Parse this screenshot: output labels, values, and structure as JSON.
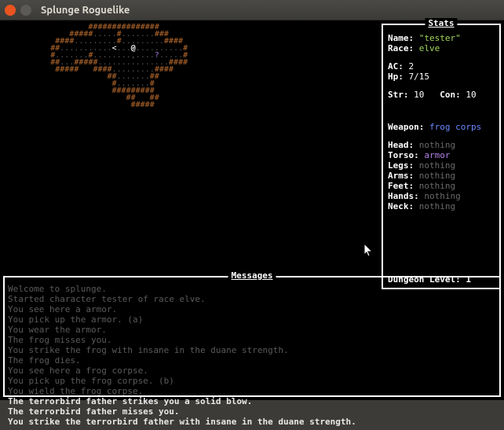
{
  "window": {
    "title": "Splunge Roguelike"
  },
  "stats": {
    "box_title": "Stats",
    "name_lbl": "Name:",
    "name_val": "\"tester\"",
    "race_lbl": "Race:",
    "race_val": "elve",
    "ac_lbl": "AC:",
    "ac_val": "2",
    "hp_lbl": "Hp:",
    "hp_val": "7/15",
    "str_lbl": "Str:",
    "str_val": "10",
    "con_lbl": "Con:",
    "con_val": "10",
    "weapon_lbl": "Weapon:",
    "weapon_val": "frog corps",
    "slots": [
      {
        "lbl": "Head:",
        "val": "nothing",
        "cls": "val-dim"
      },
      {
        "lbl": "Torso:",
        "val": "armor",
        "cls": "val-purp"
      },
      {
        "lbl": "Legs:",
        "val": "nothing",
        "cls": "val-dim"
      },
      {
        "lbl": "Arms:",
        "val": "nothing",
        "cls": "val-dim"
      },
      {
        "lbl": "Feet:",
        "val": "nothing",
        "cls": "val-dim"
      },
      {
        "lbl": "Hands:",
        "val": "nothing",
        "cls": "val-dim"
      },
      {
        "lbl": "Neck:",
        "val": "nothing",
        "cls": "val-dim"
      }
    ],
    "dungeon_lbl": "Dungeon Level:",
    "dungeon_val": "1"
  },
  "messages": {
    "box_title": "Messages",
    "lines": [
      {
        "text": "Welcome to splunge.",
        "cls": "msg-dim"
      },
      {
        "text": "Started character tester of race elve.",
        "cls": "msg-dim"
      },
      {
        "text": "You see here a armor.",
        "cls": "msg-dim"
      },
      {
        "text": "You pick up the armor. (a)",
        "cls": "msg-dim"
      },
      {
        "text": "You wear the armor.",
        "cls": "msg-dim"
      },
      {
        "text": "The frog misses you.",
        "cls": "msg-dim"
      },
      {
        "text": "You strike the frog with insane in the duane strength.",
        "cls": "msg-dim"
      },
      {
        "text": "The frog dies.",
        "cls": "msg-dim"
      },
      {
        "text": "You see here a frog corpse.",
        "cls": "msg-dim"
      },
      {
        "text": "You pick up the frog corpse. (b)",
        "cls": "msg-dim"
      },
      {
        "text": "You wield the frog corpse.",
        "cls": "msg-dim"
      },
      {
        "text": "The terrorbird father strikes you a solid blow.",
        "cls": "msg-brite"
      },
      {
        "text": "The terrorbird father misses you.",
        "cls": "msg-brite"
      },
      {
        "text": "You strike the terrorbird father with insane in the duane strength.",
        "cls": "msg-brite"
      }
    ]
  },
  "map": {
    "rows": [
      "                  ###############                   ",
      "              #####.....#.......###                 ",
      "           ####.........#.........####              ",
      "          ##...........<...@..........#             ",
      "          #.......#........,....?.....#             ",
      "          ##...#####...............####             ",
      "           #####   ####.........####                ",
      "                      ##.......##                   ",
      "                       #.......#                    ",
      "                       #########                    ",
      "                          ##   ##                   ",
      "                           #####                    "
    ]
  }
}
